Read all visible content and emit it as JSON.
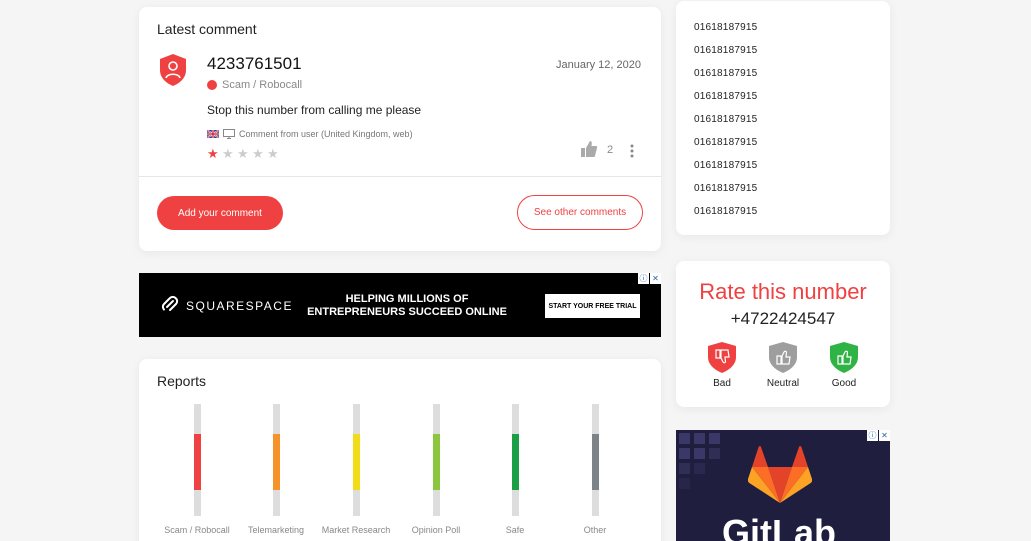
{
  "latest_comment": {
    "title": "Latest comment",
    "phone_number": "4233761501",
    "date": "January 12, 2020",
    "category": "Scam / Robocall",
    "category_color": "#ef4141",
    "text": "Stop this number from calling me please",
    "meta": "Comment from user (United Kingdom, web)",
    "rating": 1,
    "rating_max": 5,
    "likes": "2",
    "add_comment_label": "Add your comment",
    "see_other_label": "See other comments"
  },
  "numbers": [
    "01618187915",
    "01618187915",
    "01618187915",
    "01618187915",
    "01618187915",
    "01618187915",
    "01618187915",
    "01618187915",
    "01618187915"
  ],
  "rate": {
    "title": "Rate this number",
    "number": "+4722424547",
    "options": [
      {
        "label": "Bad",
        "color": "#ef4141",
        "icon": "thumb-down-icon"
      },
      {
        "label": "Neutral",
        "color": "#9e9e9e",
        "icon": "thumb-up-icon"
      },
      {
        "label": "Good",
        "color": "#2fb344",
        "icon": "thumb-up-icon"
      }
    ]
  },
  "ad_squarespace": {
    "brand": "SQUARESPACE",
    "headline_line1": "HELPING MILLIONS OF",
    "headline_line2": "ENTREPRENEURS SUCCEED ONLINE",
    "cta": "START YOUR FREE TRIAL"
  },
  "reports": {
    "title": "Reports",
    "categories": [
      {
        "label": "Scam / Robocall",
        "color": "#ef4141"
      },
      {
        "label": "Telemarketing",
        "color": "#f5922a"
      },
      {
        "label": "Market Research",
        "color": "#f2dc1a"
      },
      {
        "label": "Opinion Poll",
        "color": "#8cc63e"
      },
      {
        "label": "Safe",
        "color": "#1a9e46"
      },
      {
        "label": "Other",
        "color": "#7d8489"
      }
    ]
  },
  "ad_gitlab": {
    "word": "GitLab"
  }
}
